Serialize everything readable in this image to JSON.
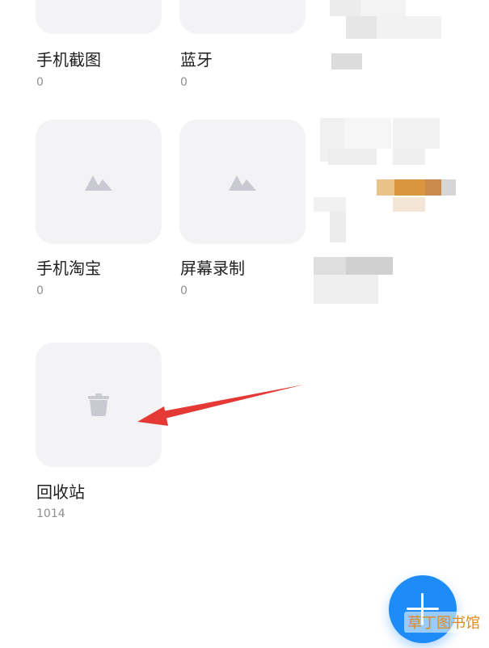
{
  "albums": [
    {
      "name": "手机截图",
      "count": "0",
      "icon": "image-placeholder-icon"
    },
    {
      "name": "蓝牙",
      "count": "0",
      "icon": "image-placeholder-icon"
    },
    {
      "name": "手机淘宝",
      "count": "0",
      "icon": "image-placeholder-icon"
    },
    {
      "name": "屏幕录制",
      "count": "0",
      "icon": "image-placeholder-icon"
    },
    {
      "name": "回收站",
      "count": "1014",
      "icon": "trash-icon"
    }
  ],
  "fab": {
    "icon": "plus-icon",
    "color": "#1d8cf8"
  },
  "annotation": {
    "color": "#e53935"
  },
  "watermark": "草丁图书馆"
}
